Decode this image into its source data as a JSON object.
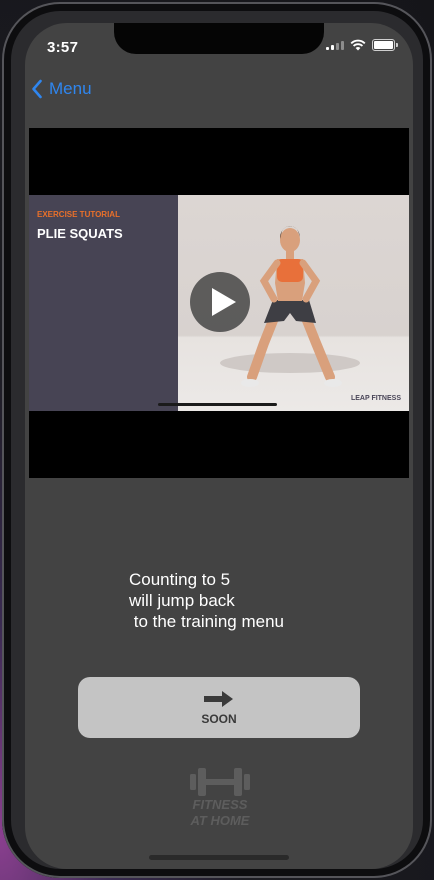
{
  "status_bar": {
    "time": "3:57"
  },
  "nav": {
    "back_label": "Menu"
  },
  "video": {
    "kicker": "EXERCISE TUTORIAL",
    "title": "PLIE SQUATS",
    "brand": "LEAP FITNESS"
  },
  "info": {
    "lines": [
      "Counting to 5",
      "will jump back",
      " to the training menu"
    ]
  },
  "action_button": {
    "label": "SOON"
  },
  "logo": {
    "line1": "FITNESS",
    "line2": "AT HOME"
  },
  "colors": {
    "accent": "#2f86ef",
    "screen_bg": "#434343",
    "button_bg": "#c4c4c4",
    "kicker": "#e9702a"
  },
  "icons": [
    "chevron-left-icon",
    "wifi-icon",
    "battery-icon",
    "play-icon",
    "arrow-right-icon",
    "dumbbell-icon"
  ]
}
